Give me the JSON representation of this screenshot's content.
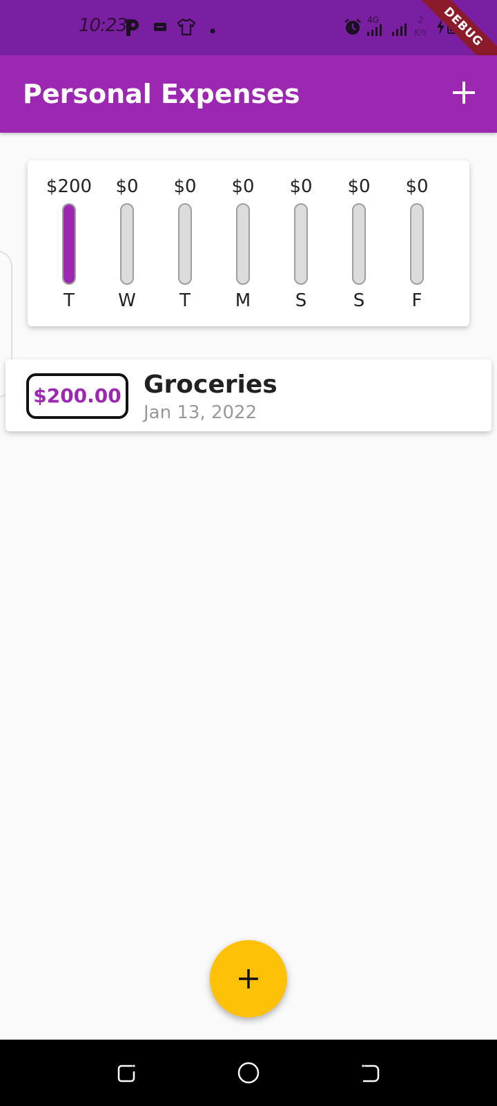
{
  "status_bar": {
    "time": "10:23",
    "network": "4G",
    "speed_top": "2",
    "speed_unit": "K/s",
    "debug_label": "DEBUG",
    "icons": [
      "pocket-icon",
      "message-icon",
      "shirt-icon",
      "dot-icon",
      "alarm-icon",
      "signal-icon",
      "signal-icon",
      "charging-icon",
      "battery-icon"
    ]
  },
  "app_bar": {
    "title": "Personal Expenses",
    "add_icon": "plus-icon"
  },
  "chart_data": {
    "type": "bar",
    "categories": [
      "T",
      "W",
      "T",
      "M",
      "S",
      "S",
      "F"
    ],
    "labels": [
      "$200",
      "$0",
      "$0",
      "$0",
      "$0",
      "$0",
      "$0"
    ],
    "values": [
      200,
      0,
      0,
      0,
      0,
      0,
      0
    ],
    "fill_fraction": [
      1,
      0,
      0,
      0,
      0,
      0,
      0
    ],
    "bar_color": "#9c27b0",
    "track_color": "#dcdcdc"
  },
  "transactions": [
    {
      "amount": "$200.00",
      "title": "Groceries",
      "date": "Jan 13, 2022"
    }
  ],
  "fab": {
    "icon": "plus-icon",
    "color": "#ffc107"
  },
  "nav_bar": {
    "icons": [
      "recents-icon",
      "home-icon",
      "back-icon"
    ]
  },
  "colors": {
    "primary": "#9c27b0",
    "status_bar": "#7b1fa2",
    "accent": "#ffc107"
  }
}
